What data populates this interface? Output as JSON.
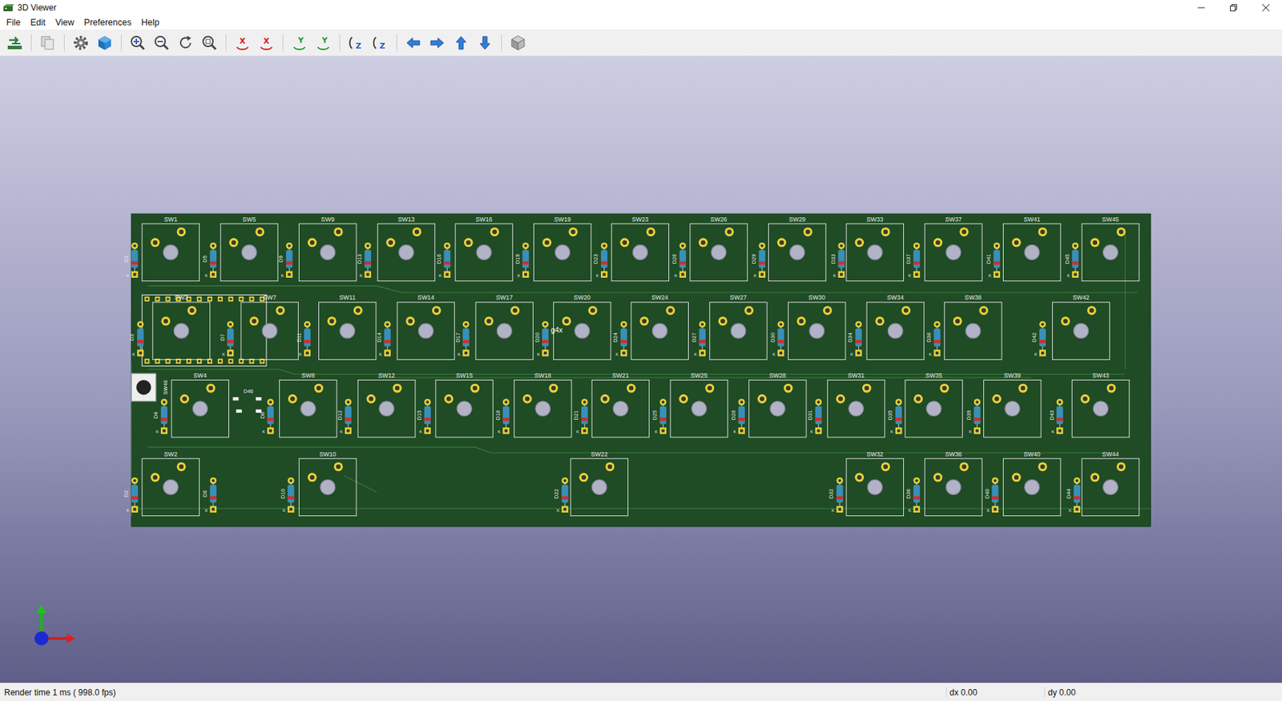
{
  "window": {
    "title": "3D Viewer"
  },
  "menu": [
    "File",
    "Edit",
    "View",
    "Preferences",
    "Help"
  ],
  "toolbar": {
    "rotate_axes": [
      {
        "glyph": "X",
        "color": "#d42020"
      },
      {
        "glyph": "X",
        "color": "#d42020"
      },
      {
        "glyph": "Y",
        "color": "#1f9a2a"
      },
      {
        "glyph": "Y",
        "color": "#1f9a2a"
      },
      {
        "glyph": "Z",
        "color": "#2a5cc8"
      },
      {
        "glyph": "Z",
        "color": "#2a5cc8"
      }
    ]
  },
  "pcb": {
    "rows": [
      {
        "switches": [
          "SW1",
          "SW5",
          "SW9",
          "SW13",
          "SW16",
          "SW19",
          "SW23",
          "SW26",
          "SW29",
          "SW33",
          "SW37",
          "SW41",
          "SW45"
        ],
        "diodes": [
          "D1",
          "D5",
          "D9",
          "D13",
          "D16",
          "D19",
          "D23",
          "D26",
          "D29",
          "D33",
          "D37",
          "D41",
          "D45"
        ]
      },
      {
        "switches": [
          "SW3",
          "SW7",
          "SW11",
          "SW14",
          "SW17",
          "SW20",
          "SW24",
          "SW27",
          "SW30",
          "SW34",
          "SW38",
          "SW42"
        ],
        "diodes": [
          "D3",
          "D7",
          "D11",
          "D14",
          "D17",
          "D20",
          "D24",
          "D27",
          "D30",
          "D34",
          "D38",
          "D42"
        ]
      },
      {
        "switches": [
          "SW4",
          "SW8",
          "SW12",
          "SW15",
          "SW18",
          "SW21",
          "SW25",
          "SW28",
          "SW31",
          "SW35",
          "SW39",
          "SW43"
        ],
        "diodes": [
          "D4",
          "D8",
          "D12",
          "D15",
          "D18",
          "D21",
          "D25",
          "D28",
          "D31",
          "D35",
          "D39",
          "D43"
        ]
      },
      {
        "switches": [
          "SW2",
          "SW10",
          "SW22",
          "SW32",
          "SW36",
          "SW40",
          "SW44"
        ],
        "diodes": [
          "D2",
          "D6",
          "D10",
          "D22",
          "D32",
          "D36",
          "D40",
          "D44"
        ]
      }
    ],
    "reset_switch": "SW46",
    "smd_diode": "D46",
    "footprint_note": "g4x",
    "cathode_mark": "K"
  },
  "status_bar": {
    "render": "Render time 1 ms ( 998.0 fps)",
    "dx": "dx 0.00",
    "dy": "dy 0.00"
  }
}
